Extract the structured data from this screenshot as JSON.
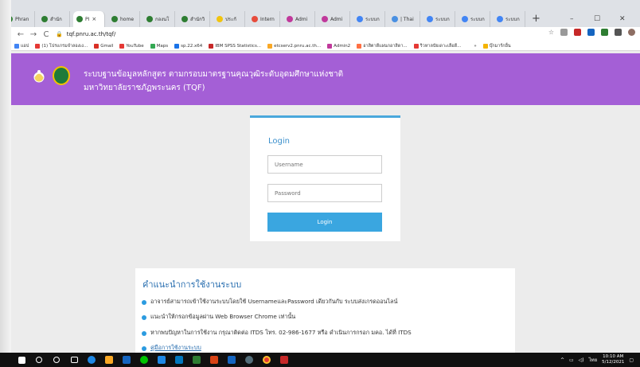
{
  "browser": {
    "tabs": [
      {
        "label": "Phran",
        "color": "#2e7d32"
      },
      {
        "label": "สำนัก",
        "color": "#2e7d32"
      },
      {
        "label": "PI",
        "color": "#2e7d32",
        "active": true
      },
      {
        "label": "home",
        "color": "#2e7d32"
      },
      {
        "label": "กองนโ",
        "color": "#2e7d32"
      },
      {
        "label": "สำนักวิ",
        "color": "#2e7d32"
      },
      {
        "label": "ประกั",
        "color": "#f1c40f"
      },
      {
        "label": "Intern",
        "color": "#e74c3c"
      },
      {
        "label": "Admi",
        "color": "#c0399b"
      },
      {
        "label": "Admi",
        "color": "#c0399b"
      },
      {
        "label": "ระบบก",
        "color": "#4285f4"
      },
      {
        "label": "| Thai",
        "color": "#4a90e2"
      },
      {
        "label": "ระบบก",
        "color": "#4285f4"
      },
      {
        "label": "ระบบก",
        "color": "#4285f4"
      },
      {
        "label": "ระบบก",
        "color": "#4285f4"
      }
    ],
    "tab_close": "×",
    "new_tab": "+",
    "window_controls": {
      "minimize": "–",
      "maximize": "☐",
      "close": "✕"
    },
    "url": "tqf.pnru.ac.th/tqf/",
    "bookmarks": [
      {
        "label": "แอป",
        "color": "#4285f4"
      },
      {
        "label": "(1) โปรแกรมจำลองเง...",
        "color": "#e53935"
      },
      {
        "label": "Gmail",
        "color": "#d93025"
      },
      {
        "label": "YouTube",
        "color": "#e53935"
      },
      {
        "label": "Maps",
        "color": "#34a853"
      },
      {
        "label": "sp.22.x64",
        "color": "#1a73e8"
      },
      {
        "label": "IBM SPSS Statistics...",
        "color": "#c62828"
      },
      {
        "label": "etcserv2.pnru.ac.th...",
        "color": "#f9a825"
      },
      {
        "label": "Admin2",
        "color": "#c0399b"
      },
      {
        "label": "อาสิตาดีแผนกอาสิดา...",
        "color": "#ff7043"
      },
      {
        "label": "ริวหาลบัยเดาะเลือดี...",
        "color": "#e53935"
      },
      {
        "label": "»",
        "color": "#ffffff"
      },
      {
        "label": "บุ๊กมาร์กอื่น",
        "color": "#f4b400"
      }
    ]
  },
  "header": {
    "line1": "ระบบฐานข้อมูลหลักสูตร ตามกรอบมาตรฐานคุณวุฒิระดับอุดมศึกษาแห่งชาติ",
    "line2": "มหาวิทยาลัยราชภัฏพระนคร (TQF)"
  },
  "login": {
    "title": "Login",
    "username_placeholder": "Username",
    "password_placeholder": "Password",
    "button": "Login"
  },
  "help": {
    "title": "คำแนะนำการใช้งานระบบ",
    "items": [
      "อาจารย์สามารถเข้าใช้งานระบบโดยใช้ UsernameและPassword เดียวกันกับ ระบบส่งเกรดออนไลน์",
      "แนะนำให้กรอกข้อมูลผ่าน Web Browser Chrome เท่านั้น",
      "หากพบปัญหาในการใช้งาน กรุณาติดต่อ ITDS โทร. 02-986-1677 หรือ ดำเนินการกรอก มคอ. ได้ที่ ITDS",
      "คู่มือการใช้งานระบบ"
    ]
  },
  "taskbar": {
    "time": "10:10 AM",
    "date": "5/12/2021",
    "lang": "ไทย"
  }
}
